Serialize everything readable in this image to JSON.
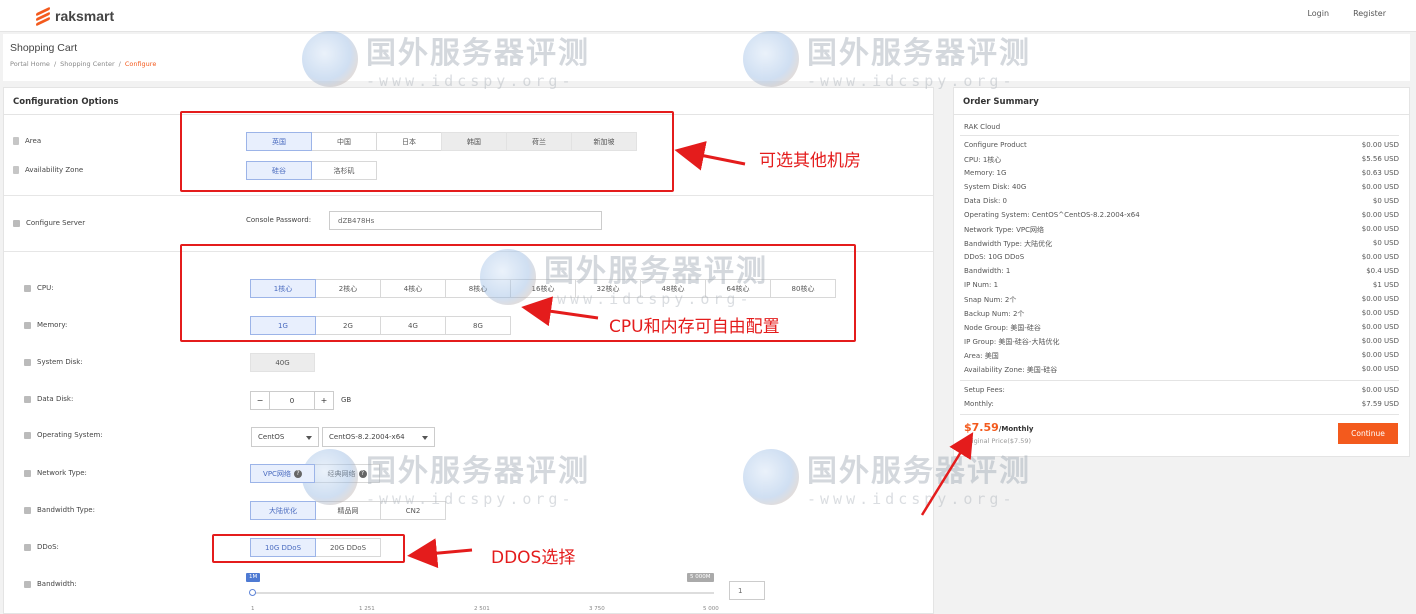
{
  "topbar": {
    "brand": "raksmart",
    "login": "Login",
    "register": "Register"
  },
  "header": {
    "title": "Shopping Cart",
    "breadcrumb": [
      "Portal Home",
      "/",
      "Shopping Center",
      "/",
      "Configure"
    ]
  },
  "config": {
    "heading": "Configuration Options",
    "area": {
      "label": "Area",
      "options": [
        "英国",
        "中国",
        "日本",
        "韩国",
        "荷兰",
        "新加坡"
      ],
      "selected": "英国"
    },
    "zone": {
      "label": "Availability Zone",
      "options": [
        "硅谷",
        "洛杉矶"
      ],
      "selected": "硅谷"
    },
    "server": {
      "label": "Configure Server",
      "password_label": "Console Password:",
      "password_value": "dZB478Hs"
    },
    "cpu": {
      "label": "CPU:",
      "options": [
        "1核心",
        "2核心",
        "4核心",
        "8核心",
        "16核心",
        "32核心",
        "48核心",
        "64核心",
        "80核心"
      ],
      "selected": "1核心"
    },
    "memory": {
      "label": "Memory:",
      "options": [
        "1G",
        "2G",
        "4G",
        "8G"
      ],
      "selected": "1G"
    },
    "system_disk": {
      "label": "System Disk:",
      "options": [
        "40G"
      ],
      "selected": "40G"
    },
    "data_disk": {
      "label": "Data Disk:",
      "minus": "−",
      "value": "0",
      "plus": "+",
      "unit": "GB"
    },
    "os": {
      "label": "Operating System:",
      "family": "CentOS",
      "version": "CentOS-8.2.2004-x64"
    },
    "network": {
      "label": "Network Type:",
      "options": [
        "VPC网络",
        "经典网络"
      ],
      "selected": "VPC网络",
      "help": "?"
    },
    "bandwidth_type": {
      "label": "Bandwidth Type:",
      "options": [
        "大陆优化",
        "精品网",
        "CN2"
      ],
      "selected": "大陆优化"
    },
    "ddos": {
      "label": "DDoS:",
      "options": [
        "10G DDoS",
        "20G DDoS"
      ],
      "selected": "10G DDoS"
    },
    "bandwidth": {
      "label": "Bandwidth:",
      "min_badge": "1M",
      "max_badge": "5 000M",
      "ticks": [
        "1",
        "1 251",
        "2 501",
        "3 750",
        "5 000"
      ],
      "value": "1",
      "slider_fraction": 0.0
    }
  },
  "order": {
    "heading": "Order Summary",
    "product": "RAK Cloud",
    "lines": [
      {
        "label": "Configure Product",
        "value": "$0.00 USD"
      },
      {
        "label": "CPU: 1核心",
        "value": "$5.56 USD"
      },
      {
        "label": "Memory: 1G",
        "value": "$0.63 USD"
      },
      {
        "label": "System Disk: 40G",
        "value": "$0.00 USD"
      },
      {
        "label": "Data Disk: 0",
        "value": "$0 USD"
      },
      {
        "label": "Operating System: CentOS^CentOS-8.2.2004-x64",
        "value": "$0.00 USD"
      },
      {
        "label": "Network Type: VPC网络",
        "value": "$0.00 USD"
      },
      {
        "label": "Bandwidth Type: 大陆优化",
        "value": "$0 USD"
      },
      {
        "label": "DDoS: 10G DDoS",
        "value": "$0.00 USD"
      },
      {
        "label": "Bandwidth: 1",
        "value": "$0.4 USD"
      },
      {
        "label": "IP Num: 1",
        "value": "$1 USD"
      },
      {
        "label": "Snap Num: 2个",
        "value": "$0.00 USD"
      },
      {
        "label": "Backup Num: 2个",
        "value": "$0.00 USD"
      },
      {
        "label": "Node Group: 美国-硅谷",
        "value": "$0.00 USD"
      },
      {
        "label": "IP Group: 美国-硅谷-大陆优化",
        "value": "$0.00 USD"
      },
      {
        "label": "Area: 美国",
        "value": "$0.00 USD"
      },
      {
        "label": "Availability Zone: 美国-硅谷",
        "value": "$0.00 USD"
      }
    ],
    "setup_label": "Setup Fees:",
    "setup_value": "$0.00 USD",
    "monthly_label": "Monthly:",
    "monthly_value": "$7.59 USD",
    "total": "$7.59",
    "total_unit": "/Monthly",
    "original": "Original Price($7.59)",
    "continue": "Continue"
  },
  "annotations": {
    "rooms": "可选其他机房",
    "cpu_mem": "CPU和内存可自由配置",
    "ddos": "DDOS选择"
  },
  "watermark": {
    "cn": "国外服务器评测",
    "en": "-www.idcspy.org-"
  },
  "colors": {
    "accent": "#f35a1d",
    "selected": "#e8effd",
    "annotation": "#e41c1c"
  }
}
